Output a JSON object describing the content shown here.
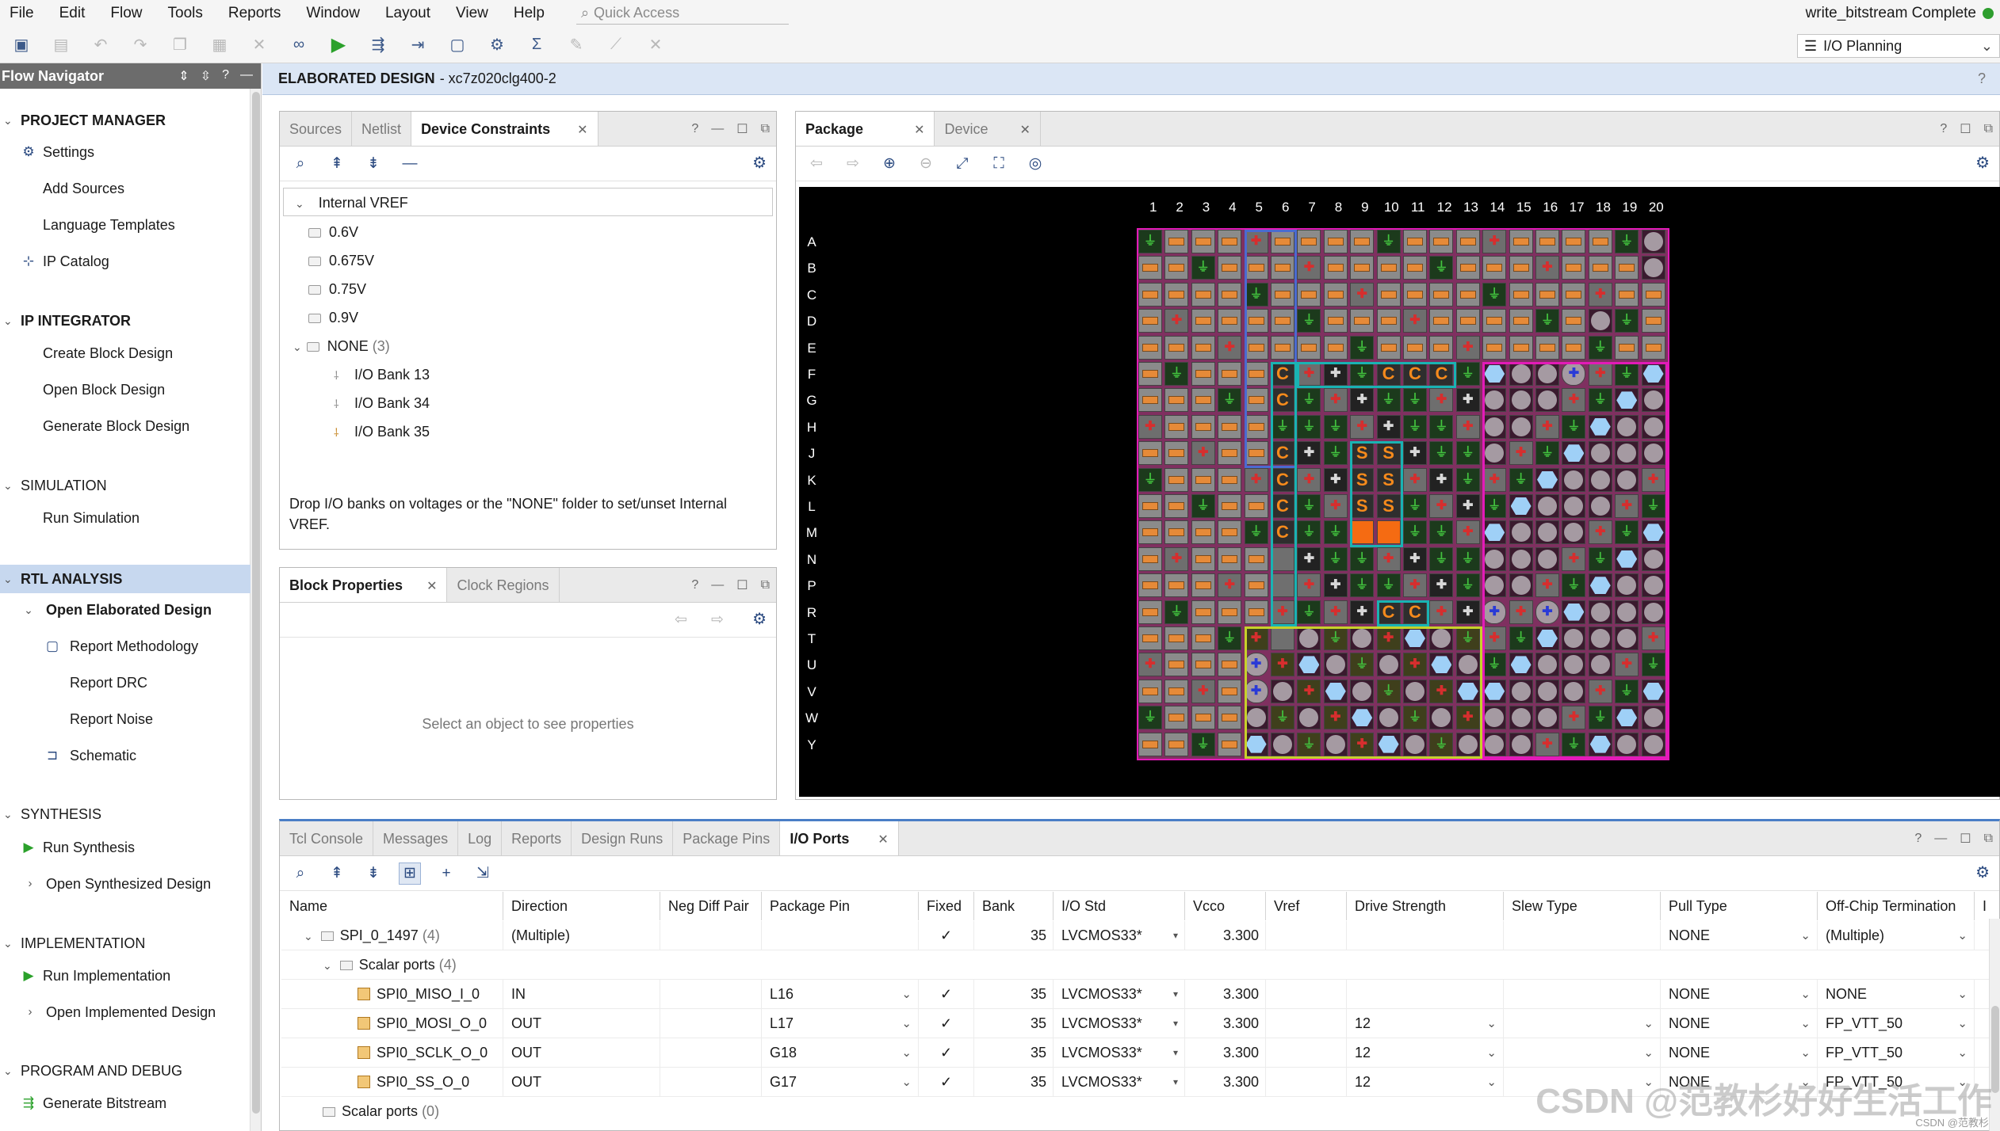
{
  "menubar": {
    "items": [
      "File",
      "Edit",
      "Flow",
      "Tools",
      "Reports",
      "Window",
      "Layout",
      "View",
      "Help"
    ],
    "quick_access": "Quick Access",
    "status": "write_bitstream Complete"
  },
  "layout_selector": {
    "value": "I/O Planning"
  },
  "flow_navigator": {
    "title": "Flow Navigator",
    "sections": [
      {
        "label": "PROJECT MANAGER"
      },
      {
        "label": "IP INTEGRATOR"
      },
      {
        "label": "SIMULATION"
      },
      {
        "label": "RTL ANALYSIS"
      },
      {
        "label": "SYNTHESIS"
      },
      {
        "label": "IMPLEMENTATION"
      },
      {
        "label": "PROGRAM AND DEBUG"
      }
    ],
    "items": {
      "settings": "Settings",
      "add_sources": "Add Sources",
      "language_templates": "Language Templates",
      "ip_catalog": "IP Catalog",
      "create_block_design": "Create Block Design",
      "open_block_design": "Open Block Design",
      "generate_block_design": "Generate Block Design",
      "run_simulation": "Run Simulation",
      "open_elaborated_design": "Open Elaborated Design",
      "report_methodology": "Report Methodology",
      "report_drc": "Report DRC",
      "report_noise": "Report Noise",
      "schematic": "Schematic",
      "run_synthesis": "Run Synthesis",
      "open_synthesized_design": "Open Synthesized Design",
      "run_implementation": "Run Implementation",
      "open_implemented_design": "Open Implemented Design",
      "generate_bitstream": "Generate Bitstream"
    }
  },
  "banner": {
    "title": "ELABORATED DESIGN",
    "device": "- xc7z020clg400-2"
  },
  "constraints_panel": {
    "tabs": [
      "Sources",
      "Netlist",
      "Device Constraints"
    ],
    "tree": {
      "root": "Internal VREF",
      "voltages": [
        "0.6V",
        "0.675V",
        "0.75V",
        "0.9V"
      ],
      "none_label": "NONE",
      "none_count": "(3)",
      "banks": [
        "I/O Bank 13",
        "I/O Bank 34",
        "I/O Bank 35"
      ]
    },
    "hint": "Drop I/O banks on voltages or the \"NONE\" folder to set/unset Internal VREF."
  },
  "properties_panel": {
    "tabs": [
      "Block Properties",
      "Clock Regions"
    ],
    "empty": "Select an object to see properties"
  },
  "package_panel": {
    "tabs": [
      "Package",
      "Device"
    ],
    "columns": [
      "1",
      "2",
      "3",
      "4",
      "5",
      "6",
      "7",
      "8",
      "9",
      "10",
      "11",
      "12",
      "13",
      "14",
      "15",
      "16",
      "17",
      "18",
      "19",
      "20"
    ],
    "rows": [
      "A",
      "B",
      "C",
      "D",
      "E",
      "F",
      "G",
      "H",
      "J",
      "K",
      "L",
      "M",
      "N",
      "P",
      "R",
      "T",
      "U",
      "V",
      "W",
      "Y"
    ],
    "pin_glyphs": {
      "clock": "C",
      "spi": "S"
    }
  },
  "bottom_panel": {
    "tabs": [
      "Tcl Console",
      "Messages",
      "Log",
      "Reports",
      "Design Runs",
      "Package Pins",
      "I/O Ports"
    ],
    "headers": [
      "Name",
      "Direction",
      "Neg Diff Pair",
      "Package Pin",
      "Fixed",
      "Bank",
      "I/O Std",
      "Vcco",
      "Vref",
      "Drive Strength",
      "Slew Type",
      "Pull Type",
      "Off-Chip Termination",
      "I"
    ],
    "group": {
      "name": "SPI_0_1497",
      "count": "(4)",
      "direction": "(Multiple)",
      "fixed": "✓",
      "bank": "35",
      "iostd": "LVCMOS33*",
      "vcco": "3.300",
      "pull": "NONE",
      "term": "(Multiple)"
    },
    "scalar_group": {
      "name": "Scalar ports",
      "count": "(4)"
    },
    "rows": [
      {
        "name": "SPI0_MISO_I_0",
        "direction": "IN",
        "pin": "L16",
        "fixed": "✓",
        "bank": "35",
        "iostd": "LVCMOS33*",
        "vcco": "3.300",
        "drive": "",
        "pull": "NONE",
        "term": "NONE"
      },
      {
        "name": "SPI0_MOSI_O_0",
        "direction": "OUT",
        "pin": "L17",
        "fixed": "✓",
        "bank": "35",
        "iostd": "LVCMOS33*",
        "vcco": "3.300",
        "drive": "12",
        "pull": "NONE",
        "term": "FP_VTT_50"
      },
      {
        "name": "SPI0_SCLK_O_0",
        "direction": "OUT",
        "pin": "G18",
        "fixed": "✓",
        "bank": "35",
        "iostd": "LVCMOS33*",
        "vcco": "3.300",
        "drive": "12",
        "pull": "NONE",
        "term": "FP_VTT_50"
      },
      {
        "name": "SPI0_SS_O_0",
        "direction": "OUT",
        "pin": "G17",
        "fixed": "✓",
        "bank": "35",
        "iostd": "LVCMOS33*",
        "vcco": "3.300",
        "drive": "12",
        "pull": "NONE",
        "term": "FP_VTT_50"
      }
    ],
    "scalar_bottom": {
      "name": "Scalar ports",
      "count": "(0)"
    }
  },
  "watermark": "CSDN @范教杉好好生活工作",
  "watermark_small": "CSDN @范教杉"
}
